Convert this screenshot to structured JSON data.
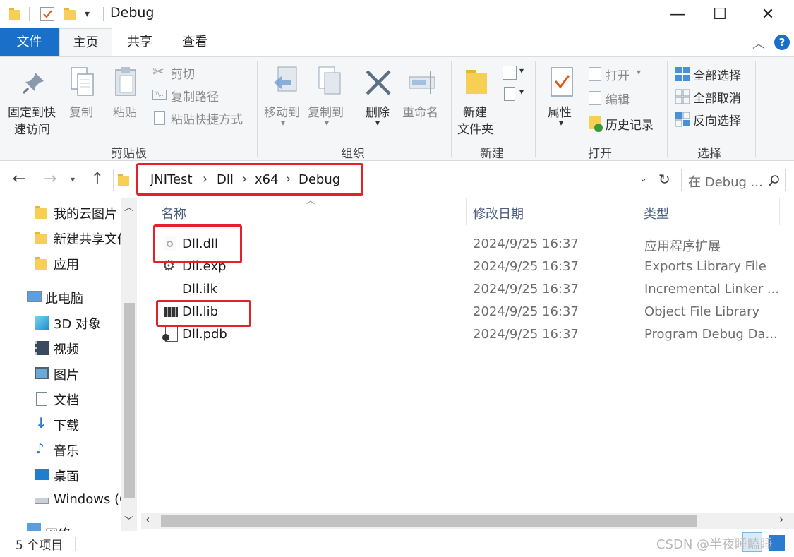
{
  "window": {
    "title": "Debug",
    "minimize_glyph": "—",
    "maximize_glyph": "☐",
    "close_glyph": "✕"
  },
  "tabs": [
    {
      "label": "文件"
    },
    {
      "label": "主页"
    },
    {
      "label": "共享"
    },
    {
      "label": "查看"
    }
  ],
  "ribbon": {
    "clipboard": {
      "pin_label_1": "固定到快",
      "pin_label_2": "速访问",
      "copy": "复制",
      "paste": "粘贴",
      "cut": "剪切",
      "copy_path": "复制路径",
      "paste_shortcut": "粘贴快捷方式",
      "group": "剪贴板"
    },
    "organize": {
      "move_to": "移动到",
      "copy_to": "复制到",
      "delete": "删除",
      "rename": "重命名",
      "group": "组织"
    },
    "new": {
      "new_folder_1": "新建",
      "new_folder_2": "文件夹",
      "group": "新建"
    },
    "open": {
      "properties": "属性",
      "open": "打开",
      "edit": "编辑",
      "history": "历史记录",
      "group": "打开"
    },
    "select": {
      "select_all": "全部选择",
      "select_none": "全部取消",
      "invert": "反向选择",
      "group": "选择"
    }
  },
  "address": {
    "crumbs": [
      "JNITest",
      "Dll",
      "x64",
      "Debug"
    ],
    "search_placeholder": "在 Debug ..."
  },
  "sidebar": {
    "items": [
      {
        "label": "我的云图片",
        "icon": "folder-icon"
      },
      {
        "label": "新建共享文件夹",
        "icon": "shared-folder-icon"
      },
      {
        "label": "应用",
        "icon": "apps-folder-icon"
      },
      {
        "label": "此电脑",
        "icon": "computer-icon"
      },
      {
        "label": "3D 对象",
        "icon": "3d-objects-icon"
      },
      {
        "label": "视频",
        "icon": "video-icon"
      },
      {
        "label": "图片",
        "icon": "pictures-icon"
      },
      {
        "label": "文档",
        "icon": "documents-icon"
      },
      {
        "label": "下载",
        "icon": "download-icon"
      },
      {
        "label": "音乐",
        "icon": "music-icon"
      },
      {
        "label": "桌面",
        "icon": "desktop-icon"
      },
      {
        "label": "Windows (C",
        "icon": "drive-icon"
      },
      {
        "label": "网络",
        "icon": "network-icon"
      }
    ]
  },
  "files": {
    "columns": [
      "名称",
      "修改日期",
      "类型"
    ],
    "rows": [
      {
        "name": "Dll.dll",
        "date": "2024/9/25 16:37",
        "type": "应用程序扩展",
        "icon": "dll-file-icon"
      },
      {
        "name": "Dll.exp",
        "date": "2024/9/25 16:37",
        "type": "Exports Library File",
        "icon": "exp-file-icon"
      },
      {
        "name": "Dll.ilk",
        "date": "2024/9/25 16:37",
        "type": "Incremental Linker ...",
        "icon": "ilk-file-icon"
      },
      {
        "name": "Dll.lib",
        "date": "2024/9/25 16:37",
        "type": "Object File Library",
        "icon": "lib-file-icon"
      },
      {
        "name": "Dll.pdb",
        "date": "2024/9/25 16:37",
        "type": "Program Debug Da...",
        "icon": "pdb-file-icon"
      }
    ]
  },
  "status": {
    "count": "5 个项目"
  },
  "watermark": "CSDN @半夜睡瞌睡",
  "colors": {
    "accent": "#1a6fc9",
    "highlight_red": "#e5202a"
  }
}
